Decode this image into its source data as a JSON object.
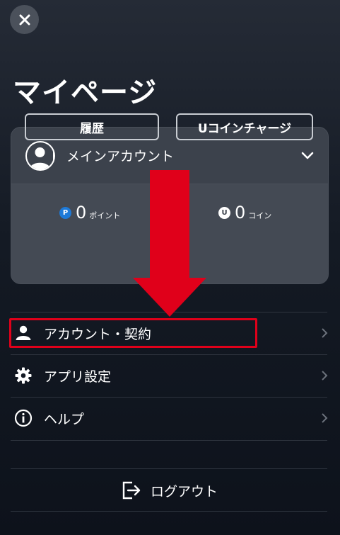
{
  "header": {
    "title": "マイページ"
  },
  "account": {
    "name": "メインアカウント",
    "points": {
      "badge": "P",
      "value": "0",
      "unit": "ポイント"
    },
    "coins": {
      "badge": "U",
      "value": "0",
      "unit": "コイン"
    },
    "history_label": "履歴",
    "charge_label": "Uコインチャージ"
  },
  "menu": {
    "items": [
      {
        "label": "アカウント・契約",
        "icon": "person-icon"
      },
      {
        "label": "アプリ設定",
        "icon": "gear-icon"
      },
      {
        "label": "ヘルプ",
        "icon": "info-icon"
      }
    ]
  },
  "logout": {
    "label": "ログアウト"
  },
  "colors": {
    "annotation": "#e0001a",
    "points_badge": "#1e7ad8",
    "text": "#ffffff"
  }
}
